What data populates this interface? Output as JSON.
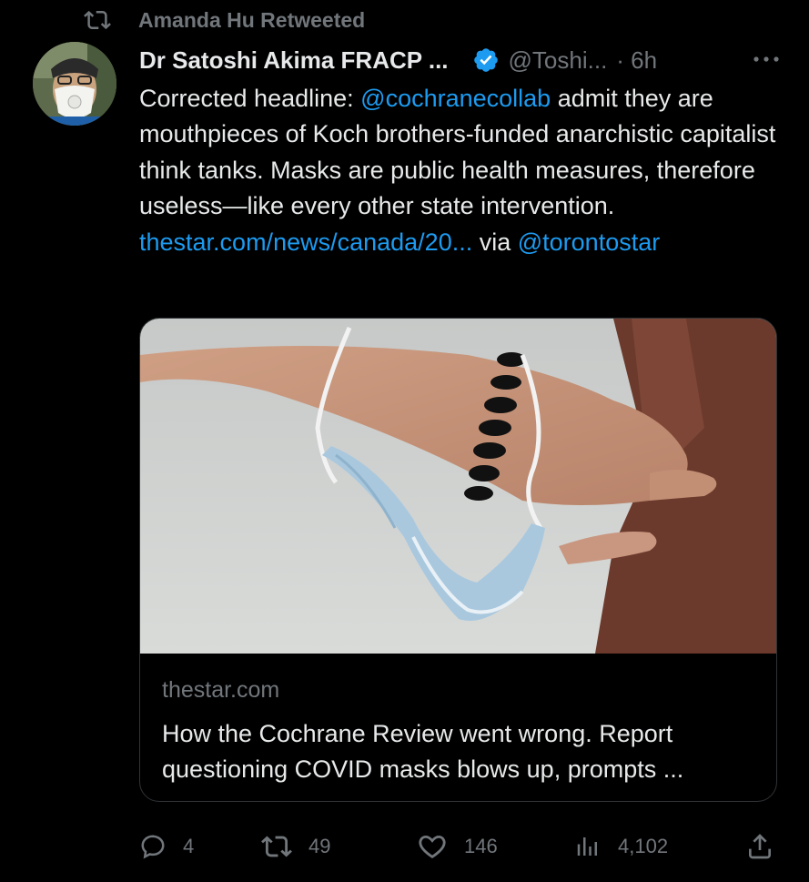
{
  "social_context": {
    "text": "Amanda Hu Retweeted",
    "icon": "retweet-icon"
  },
  "author": {
    "display_name": "Dr Satoshi Akima FRACP ...",
    "handle": "@Toshi...",
    "time": "· 6h",
    "verified_color": "#1d9bf0"
  },
  "tweet": {
    "part1": "Corrected headline: ",
    "mention1": "@cochranecollab",
    "part2": " admit they are mouthpieces of Koch brothers-funded anarchistic capitalist think tanks. Masks are public health measures, therefore useless—like every other state intervention.  ",
    "link": "thestar.com/news/canada/20...",
    "part3": " via ",
    "mention2": "@torontostar"
  },
  "card": {
    "domain": "thestar.com",
    "title": "How the Cochrane Review went wrong. Report questioning COVID masks blows up, prompts ..."
  },
  "actions": {
    "replies": "4",
    "retweets": "49",
    "likes": "146",
    "views": "4,102"
  },
  "colors": {
    "background": "#000000",
    "text": "#e7e9ea",
    "muted": "#71767b",
    "link": "#1d9bf0",
    "border": "#2f3336"
  }
}
